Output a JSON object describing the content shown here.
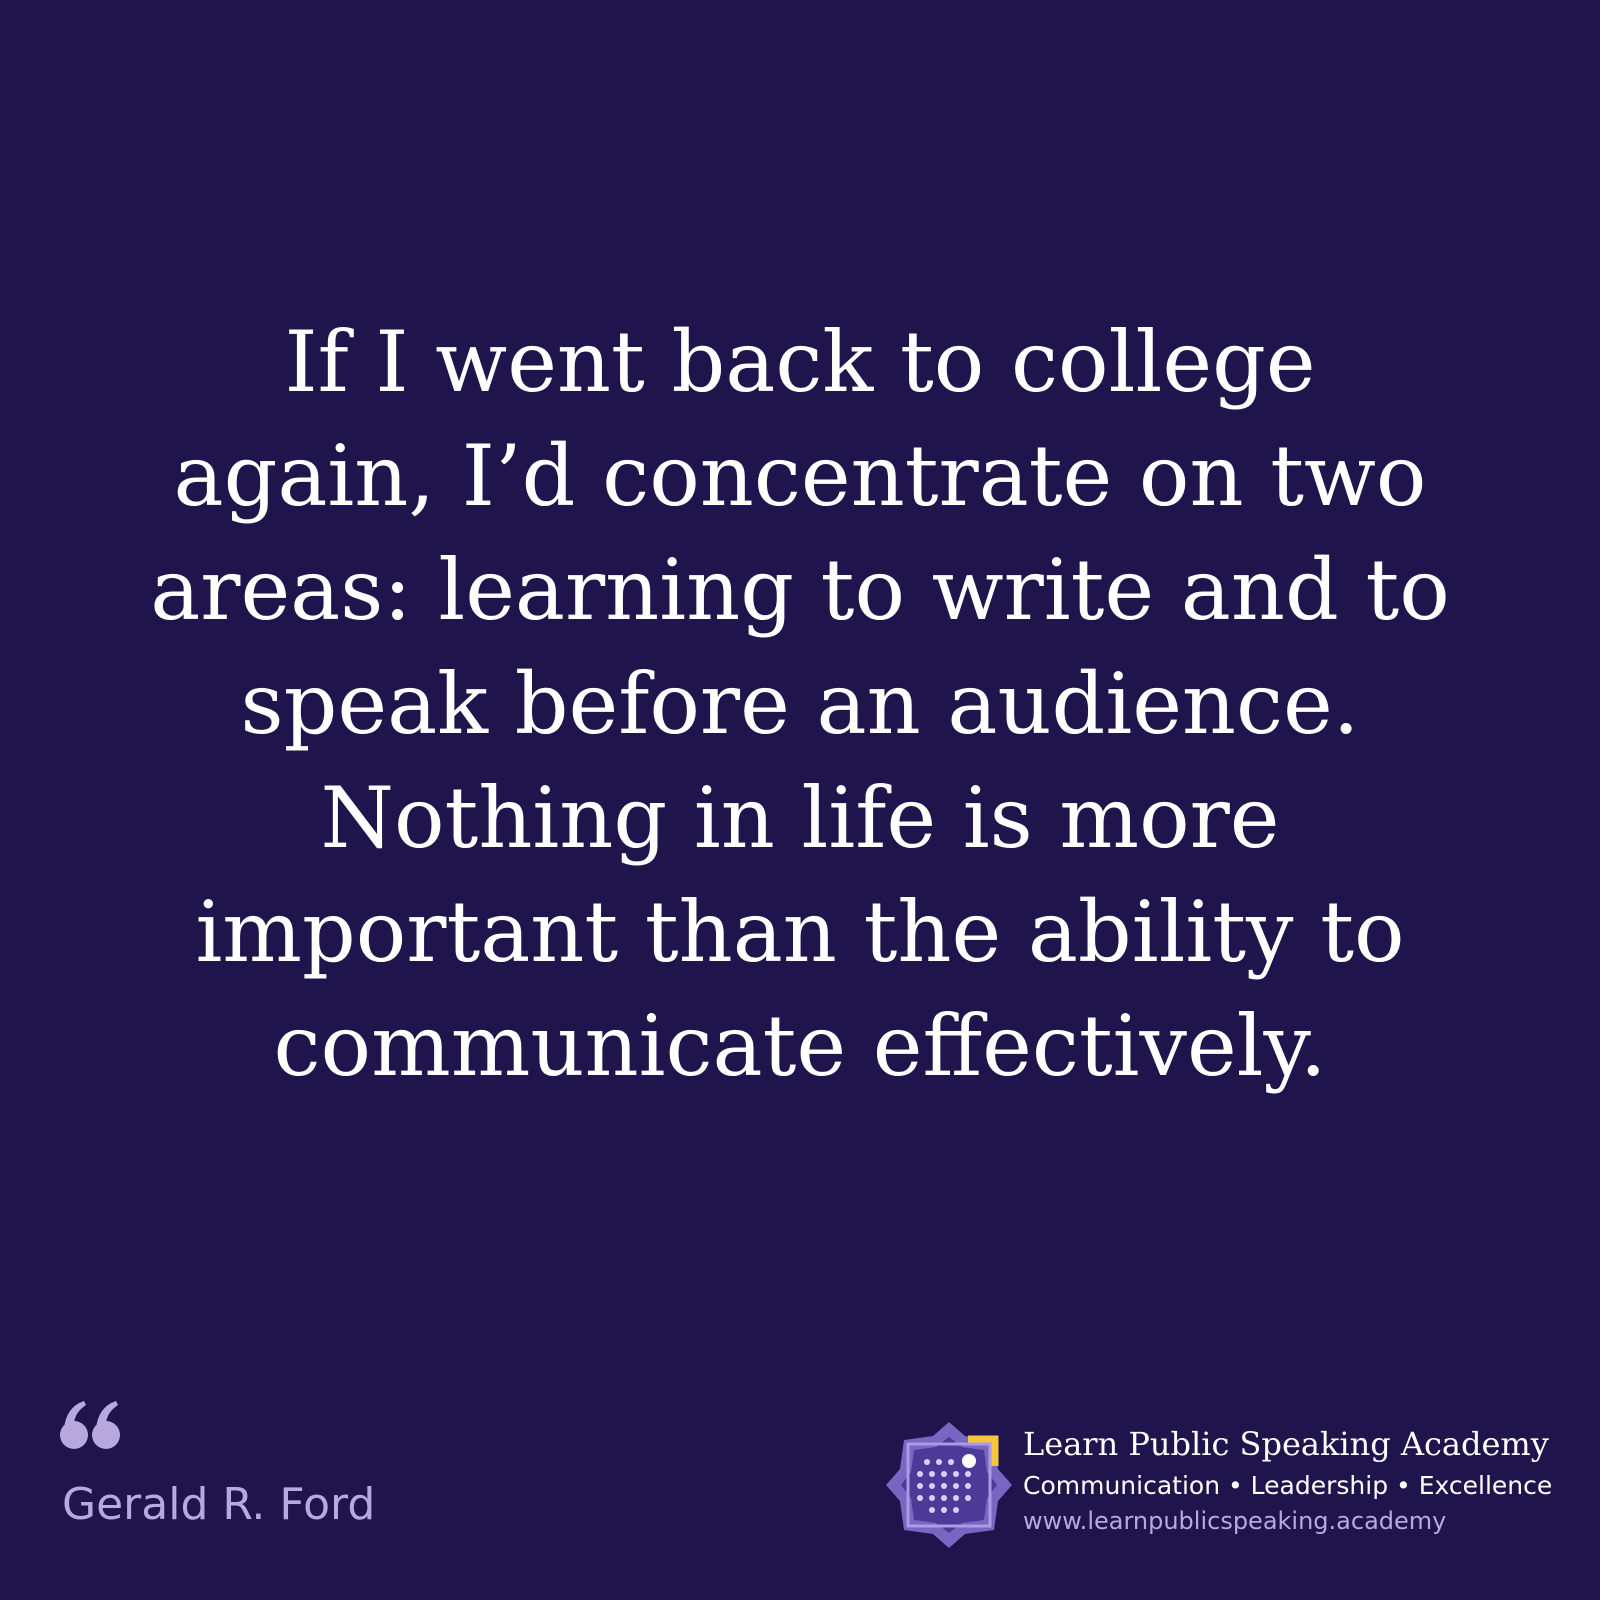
{
  "colors": {
    "background": "#20144d",
    "quote_text": "#ffffff",
    "accent": "#b7a9dd",
    "logo_purple": "#7c6bc8",
    "logo_gold": "#f4c542"
  },
  "quote": {
    "text": "If I went back to college again, I’d concentrate on two areas: learning to write and to speak before an audience. Nothing in life is more important than the ability to communicate effectively.",
    "mark_icon": "quote-mark-icon"
  },
  "author": {
    "name": "Gerald R. Ford"
  },
  "brand": {
    "logo_icon": "learn-public-speaking-academy-logo",
    "name": "Learn Public Speaking Academy",
    "tagline": "Communication • Leadership • Excellence",
    "url": "www.learnpublicspeaking.academy"
  }
}
